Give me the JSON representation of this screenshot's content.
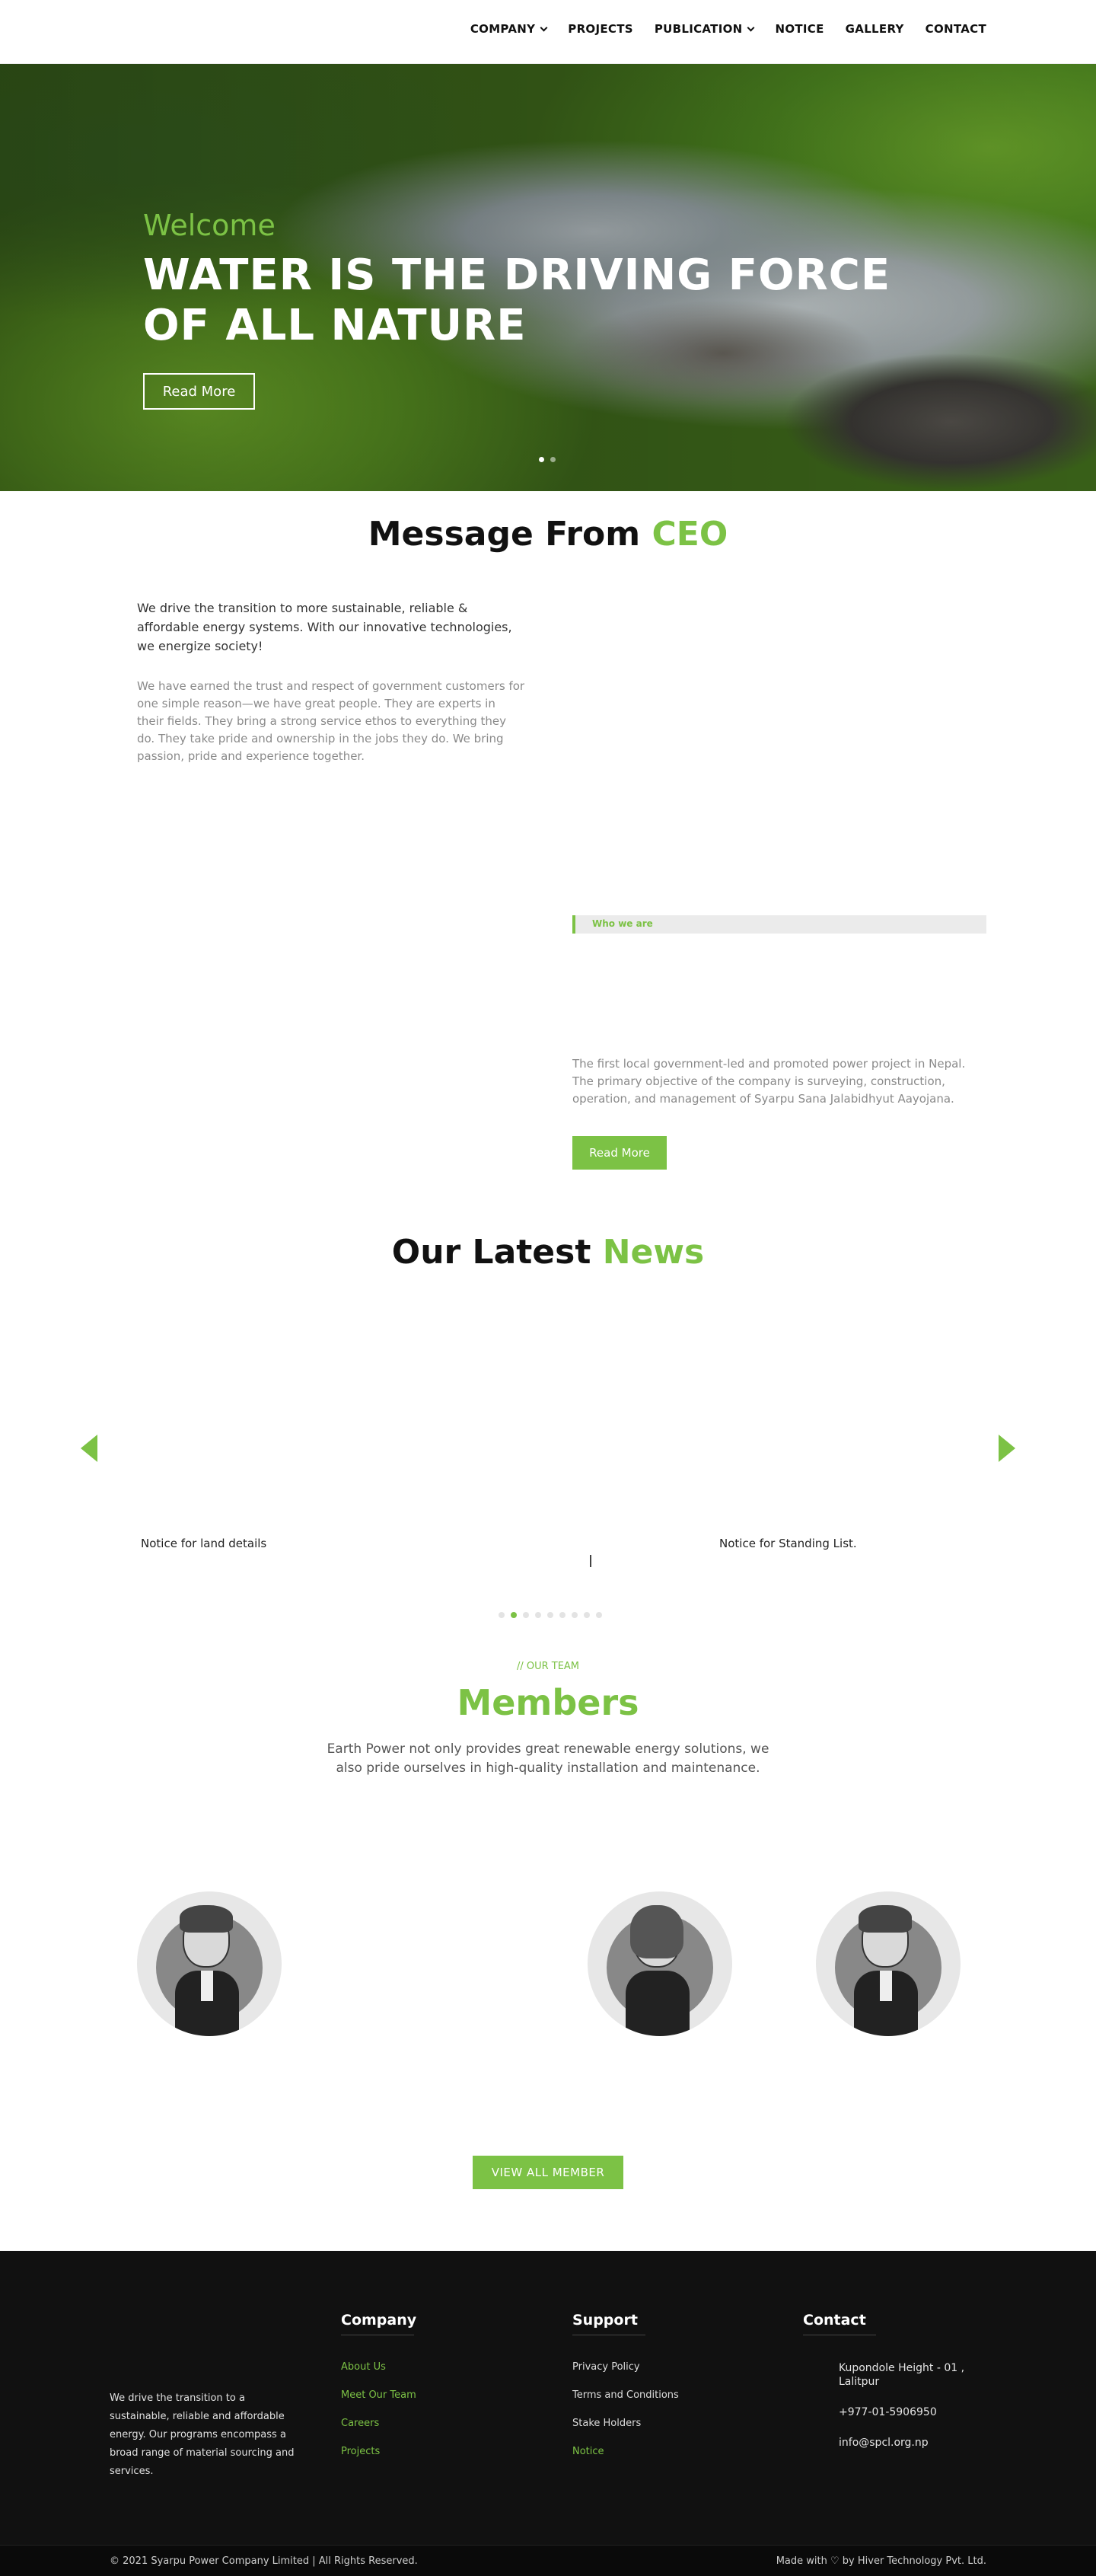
{
  "nav": [
    {
      "label": "COMPANY",
      "dropdown": true
    },
    {
      "label": "PROJECTS",
      "dropdown": false
    },
    {
      "label": "PUBLICATION",
      "dropdown": true
    },
    {
      "label": "NOTICE",
      "dropdown": false
    },
    {
      "label": "GALLERY",
      "dropdown": false
    },
    {
      "label": "CONTACT",
      "dropdown": false
    }
  ],
  "hero": {
    "welcome": "Welcome",
    "title": "WATER IS THE DRIVING FORCE OF ALL NATURE",
    "button": "Read More",
    "slides": 2,
    "active_slide": 1
  },
  "ceo": {
    "title_main": "Message From ",
    "title_accent": "CEO",
    "lead": "We drive the transition to more sustainable, reliable & affordable energy systems. With our innovative technologies, we energize society!",
    "body": "We have earned the trust and respect of government customers for one simple reason—we have great people. They are experts in their fields. They bring a strong service ethos to everything they do. They take pride and ownership in the jobs they do. We bring passion, pride and experience together."
  },
  "who": {
    "label": "Who we are",
    "text": "The first local government-led and promoted power project in Nepal. The primary objective of the company is surveying, construction, operation, and management of Syarpu Sana Jalabidhyut Aayojana.",
    "button": "Read More"
  },
  "news": {
    "title_main": "Our Latest ",
    "title_accent": "News",
    "items": [
      "Notice for land details",
      "Notice for Standing List."
    ],
    "dots": 9,
    "active_dot": 1
  },
  "members": {
    "eyebrow": "// OUR TEAM",
    "title": "Members",
    "desc": "Earth Power not only provides great renewable energy solutions, we also pride ourselves in high-quality installation and maintenance.",
    "button": "VIEW ALL MEMBER"
  },
  "footer": {
    "about": "We drive the transition to a sustainable, reliable and affordable energy. Our programs encompass a broad range of material sourcing and services.",
    "company": {
      "title": "Company",
      "links": [
        "About Us",
        "Meet Our Team",
        "Careers",
        "Projects"
      ]
    },
    "support": {
      "title": "Support",
      "links": [
        "Privacy Policy",
        "Terms and Conditions",
        "Stake Holders",
        "Notice"
      ]
    },
    "contact": {
      "title": "Contact",
      "address": "Kupondole Height - 01 , Lalitpur",
      "phone": "+977-01-5906950",
      "email": "info@spcl.org.np"
    },
    "copyright": "© 2021 Syarpu Power Company Limited | All Rights Reserved.",
    "made_with": "Made with ♡ by Hiver Technology Pvt. Ltd."
  },
  "colors": {
    "accent": "#7cc245",
    "footer": "#111111"
  }
}
